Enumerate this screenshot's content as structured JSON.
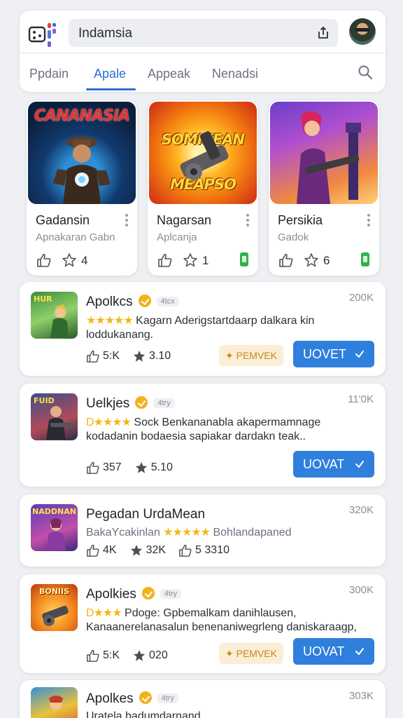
{
  "header": {
    "search_value": "Indamsia"
  },
  "tabs": [
    {
      "label": "Ppdain",
      "active": false
    },
    {
      "label": "Apale",
      "active": true
    },
    {
      "label": "Appeak",
      "active": false
    },
    {
      "label": "Nenadsi",
      "active": false
    }
  ],
  "featured": [
    {
      "art_title": "CANANASIA",
      "title": "Gadansin",
      "subtitle": "Apnakaran Gabn",
      "count": "4",
      "badge": false
    },
    {
      "art_title": "SOMIKEAN MEAPSO",
      "title": "Nagarsan",
      "subtitle": "Aplcanja",
      "count": "1",
      "badge": true
    },
    {
      "art_title": "",
      "title": "Persikia",
      "subtitle": "Gadok",
      "count": "6",
      "badge": true
    }
  ],
  "list": [
    {
      "thumb_label": "HUR",
      "title": "Apolkcs",
      "chip": "4tcx",
      "size": "200K",
      "stars": "★★★★★",
      "desc": "Kagarn Aderigstartdaarp dalkara kin loddukanang.",
      "likes": "5:K",
      "rating": "3.10",
      "premium": "PEMVEK",
      "install": "UOVET"
    },
    {
      "thumb_label": "FUID",
      "title": "Uelkjes",
      "chip": "4try",
      "size": "11'0K",
      "stars_lead": "D",
      "stars": "★★★★",
      "desc": "Sock Benkananabla akapermamnage kodadanin bodaesia sapiakar dardakn teak..",
      "likes": "357",
      "rating": "5.10",
      "install": "UOVAT"
    },
    {
      "thumb_label": "NADDNAN",
      "title": "Pegadan UrdaMean",
      "size": "320K",
      "desc_pre": "BakaYcakinlan",
      "stars": "★★★★★",
      "desc": "Bohlandapaned",
      "likes": "4K",
      "rating": "32K",
      "extra": "5 3310"
    },
    {
      "thumb_label": "BONIIS",
      "title": "Apolkies",
      "chip": "4try",
      "size": "300K",
      "stars_lead": "D",
      "stars": "★★★",
      "desc": "Pdoge: Gpbemalkam danihlausen, Kanaanerelanasalun benenaniwegrleng daniskaraagp,",
      "likes": "5:K",
      "rating": "020",
      "premium": "PEMVEK",
      "install": "UOVAT"
    },
    {
      "thumb_label": "",
      "title": "Apolkes",
      "chip": "4try",
      "size": "303K",
      "desc": "Uratela badumdarnand"
    }
  ],
  "colors": {
    "accent": "#2a6fd1",
    "install": "#2f7fdd",
    "star": "#f4b61a",
    "verified": "#f2b21d",
    "premium_bg": "#fbeed6",
    "premium_text": "#c48a1a"
  }
}
